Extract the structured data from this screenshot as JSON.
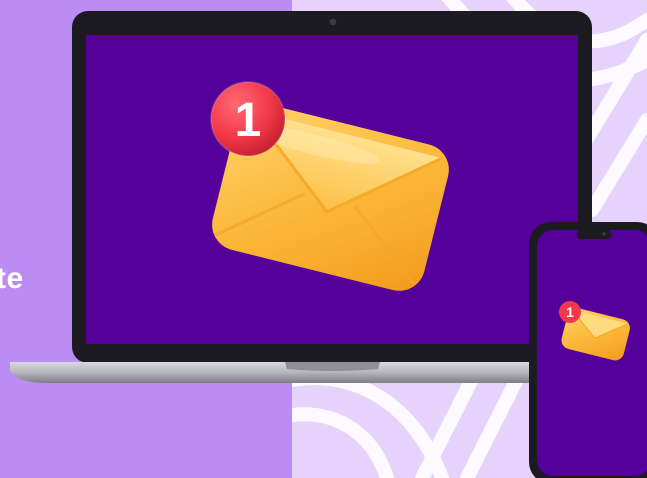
{
  "side_text": "te",
  "laptop_badge": "1",
  "phone_badge": "1",
  "icons": {
    "envelope": "envelope-icon",
    "badge": "notification-badge-icon"
  },
  "colors": {
    "background_left": "#bb8cf2",
    "background_right": "#e6d2fb",
    "screen": "#55009a",
    "envelope": "#fbb637",
    "badge": "#f2384a"
  }
}
